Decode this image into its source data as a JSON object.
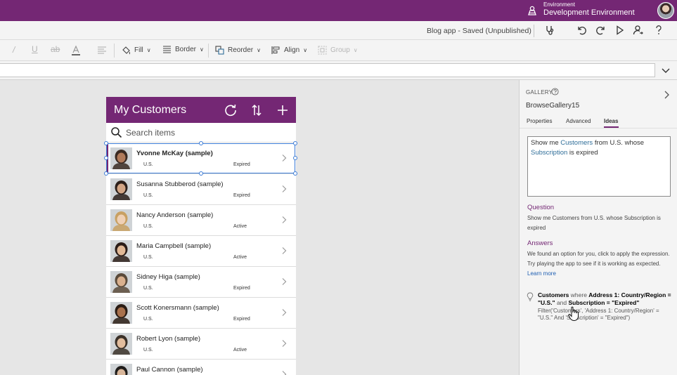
{
  "topbar": {
    "env_label": "Environment",
    "env_name": "Development Environment",
    "icons": [
      "environment-icon",
      "user-avatar"
    ]
  },
  "cmdbar": {
    "app_status": "Blog app - Saved (Unpublished)",
    "icons": [
      "stethoscope-icon",
      "undo-icon",
      "redo-icon",
      "play-icon",
      "share-icon",
      "help-icon"
    ]
  },
  "fmtbar": {
    "fill": "Fill",
    "border": "Border",
    "reorder": "Reorder",
    "align": "Align",
    "group": "Group"
  },
  "app": {
    "title": "My Customers",
    "search_placeholder": "Search items",
    "header_icons": [
      "refresh-icon",
      "sort-icon",
      "add-icon"
    ],
    "customers": [
      {
        "name": "Yvonne McKay (sample)",
        "country": "U.S.",
        "status": "Expired"
      },
      {
        "name": "Susanna Stubberod (sample)",
        "country": "U.S.",
        "status": "Expired"
      },
      {
        "name": "Nancy Anderson (sample)",
        "country": "U.S.",
        "status": "Active"
      },
      {
        "name": "Maria Campbell (sample)",
        "country": "U.S.",
        "status": "Active"
      },
      {
        "name": "Sidney Higa (sample)",
        "country": "U.S.",
        "status": "Expired"
      },
      {
        "name": "Scott Konersmann (sample)",
        "country": "U.S.",
        "status": "Expired"
      },
      {
        "name": "Robert Lyon (sample)",
        "country": "U.S.",
        "status": "Active"
      },
      {
        "name": "Paul Cannon (sample)",
        "country": "",
        "status": ""
      }
    ]
  },
  "panel": {
    "type_label": "GALLERY",
    "control_name": "BrowseGallery15",
    "tabs": [
      "Properties",
      "Advanced",
      "Ideas"
    ],
    "active_tab": "Ideas",
    "idea_text": {
      "p1": "Show me ",
      "k1": "Customers",
      "p2": " from U.S. whose ",
      "k2": "Subscription",
      "p3": " is expired"
    },
    "question_title": "Question",
    "question_text": "Show me Customers from U.S. whose Subscription is expired",
    "answers_title": "Answers",
    "answers_text": "We found an option for you, click to apply the expression. Try playing the app to see if it is working as expected.",
    "learn_more": "Learn more",
    "answer": {
      "b1": "Customers",
      "w1": " where ",
      "b2": "Address 1: Country/Region = \"U.S.\"",
      "w2": " and ",
      "b3": "Subscription = \"Expired\"",
      "formula": "Filter('Customers', 'Address 1: Country/Region' = \"U.S.\" And 'Subscription' = \"Expired\")"
    }
  },
  "colors": {
    "brand": "#742774",
    "selection": "#3b7bd6",
    "link": "#1f5fb2"
  }
}
